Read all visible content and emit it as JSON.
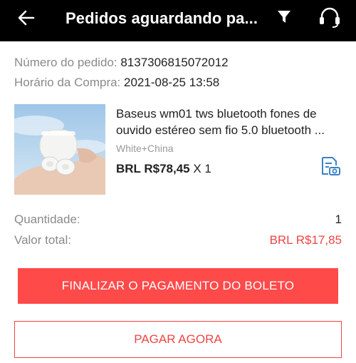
{
  "header": {
    "title": "Pedidos aguardando pa...",
    "back_icon": "arrow-left-icon",
    "filter_icon": "filter-icon",
    "support_icon": "headset-icon"
  },
  "order": {
    "number_label": "Número do pedido:",
    "number_value": "8137306815072012",
    "time_label": "Horário da Compra:",
    "time_value": "2021-08-25 13:58"
  },
  "product": {
    "title": "Baseus wm01 tws bluetooth fones de ouvido estéreo sem fio 5.0 bluetooth ...",
    "variant": "White+China",
    "price": "BRL R$78,45",
    "qty": "X 1",
    "snapshot_icon": "receipt-camera-icon"
  },
  "summary": {
    "quantity_label": "Quantidade:",
    "quantity_value": "1",
    "total_label": "Valor total:",
    "total_value": "BRL R$17,85"
  },
  "actions": {
    "primary_label": "FINALIZAR O PAGAMENTO DO BOLETO",
    "secondary_label": "PAGAR AGORA"
  },
  "colors": {
    "accent": "#ff4a4a",
    "header_bg": "#000000",
    "icon_blue": "#3b82c4"
  }
}
